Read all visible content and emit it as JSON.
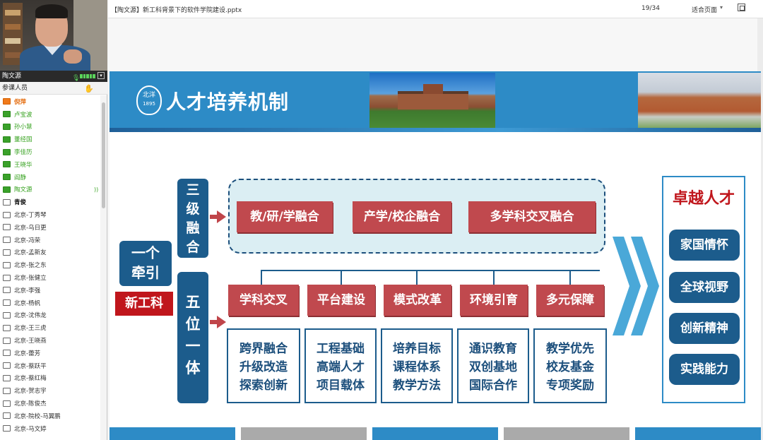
{
  "presenter": {
    "name": "陶文源"
  },
  "participants_header": "参课人员",
  "participants": [
    {
      "name": "倪萍",
      "style": "orange"
    },
    {
      "name": "卢宝波",
      "style": "green"
    },
    {
      "name": "孙小慧",
      "style": "green"
    },
    {
      "name": "董经国",
      "style": "green"
    },
    {
      "name": "李佳历",
      "style": "green"
    },
    {
      "name": "王晓华",
      "style": "green"
    },
    {
      "name": "阎静",
      "style": "green"
    },
    {
      "name": "陶文源",
      "style": "green"
    },
    {
      "name": "青俊",
      "style": "bold"
    },
    {
      "name": "北京-丁秀琴",
      "style": "normal"
    },
    {
      "name": "北京-乌日更",
      "style": "normal"
    },
    {
      "name": "北京-冯荣",
      "style": "normal"
    },
    {
      "name": "北京-孟新友",
      "style": "normal"
    },
    {
      "name": "北京-张之东",
      "style": "normal"
    },
    {
      "name": "北京-张健立",
      "style": "normal"
    },
    {
      "name": "北京-李强",
      "style": "normal"
    },
    {
      "name": "北京-杨帆",
      "style": "normal"
    },
    {
      "name": "北京-沈伟龙",
      "style": "normal"
    },
    {
      "name": "北京-王三虎",
      "style": "normal"
    },
    {
      "name": "北京-王晓燕",
      "style": "normal"
    },
    {
      "name": "北京-蕾芳",
      "style": "normal"
    },
    {
      "name": "北京-蔡跃平",
      "style": "normal"
    },
    {
      "name": "北京-蔡红梅",
      "style": "normal"
    },
    {
      "name": "北京-贺志宇",
      "style": "normal"
    },
    {
      "name": "北京-陈俊杰",
      "style": "normal"
    },
    {
      "name": "北京-院校-马翼鹏",
      "style": "normal"
    },
    {
      "name": "北京-马文婷",
      "style": "normal"
    }
  ],
  "viewer": {
    "doc_title": "【陶文源】新工科背景下的软件学院建设.pptx",
    "page_indicator": "19/34",
    "fit_label": "适合页面"
  },
  "slide": {
    "logo_text": "北洋",
    "logo_year": "1895",
    "title": "人才培养机制",
    "yige": "一个牵引",
    "xingk": "新工科",
    "san": "三级融合",
    "wu": "五位一体",
    "top_items": [
      "教/研/学融合",
      "产学/校企融合",
      "多学科交叉融合"
    ],
    "mid_items": [
      "学科交叉",
      "平台建设",
      "模式改革",
      "环境引育",
      "多元保障"
    ],
    "details": [
      [
        "跨界融合",
        "升级改造",
        "探索创新"
      ],
      [
        "工程基础",
        "高端人才",
        "项目载体"
      ],
      [
        "培养目标",
        "课程体系",
        "教学方法"
      ],
      [
        "通识教育",
        "双创基地",
        "国际合作"
      ],
      [
        "教学优先",
        "校友基金",
        "专项奖励"
      ]
    ],
    "outcome_title": "卓越人才",
    "outcomes": [
      "家国情怀",
      "全球视野",
      "创新精神",
      "实践能力"
    ]
  },
  "colors": {
    "slide_blue": "#2d8bc6",
    "navy": "#1c5c8c",
    "red_btn": "#c0494e",
    "accent_red": "#c0161c",
    "green_attendee": "#36a21f",
    "orange_attendee": "#e46a0a"
  }
}
